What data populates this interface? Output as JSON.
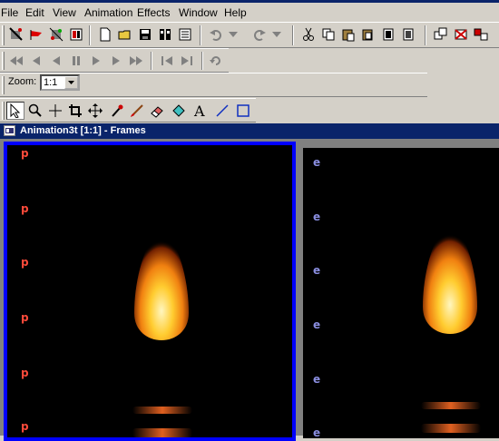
{
  "menu": [
    "File",
    "Edit",
    "View",
    "Animation",
    "Effects",
    "Window",
    "Help"
  ],
  "zoom": {
    "label": "Zoom:",
    "value": "1:1"
  },
  "document": {
    "title": "Animation3t [1:1] - Frames"
  },
  "frames": [
    {
      "marker": "p",
      "marker_color": "#ff4a3a",
      "selected": true
    },
    {
      "marker": "e",
      "marker_color": "#8a8ee0",
      "selected": false
    }
  ],
  "colors": {
    "titlebar": "#0a246a",
    "selection_border": "#0000ff",
    "selection_top": "#ff0000"
  }
}
